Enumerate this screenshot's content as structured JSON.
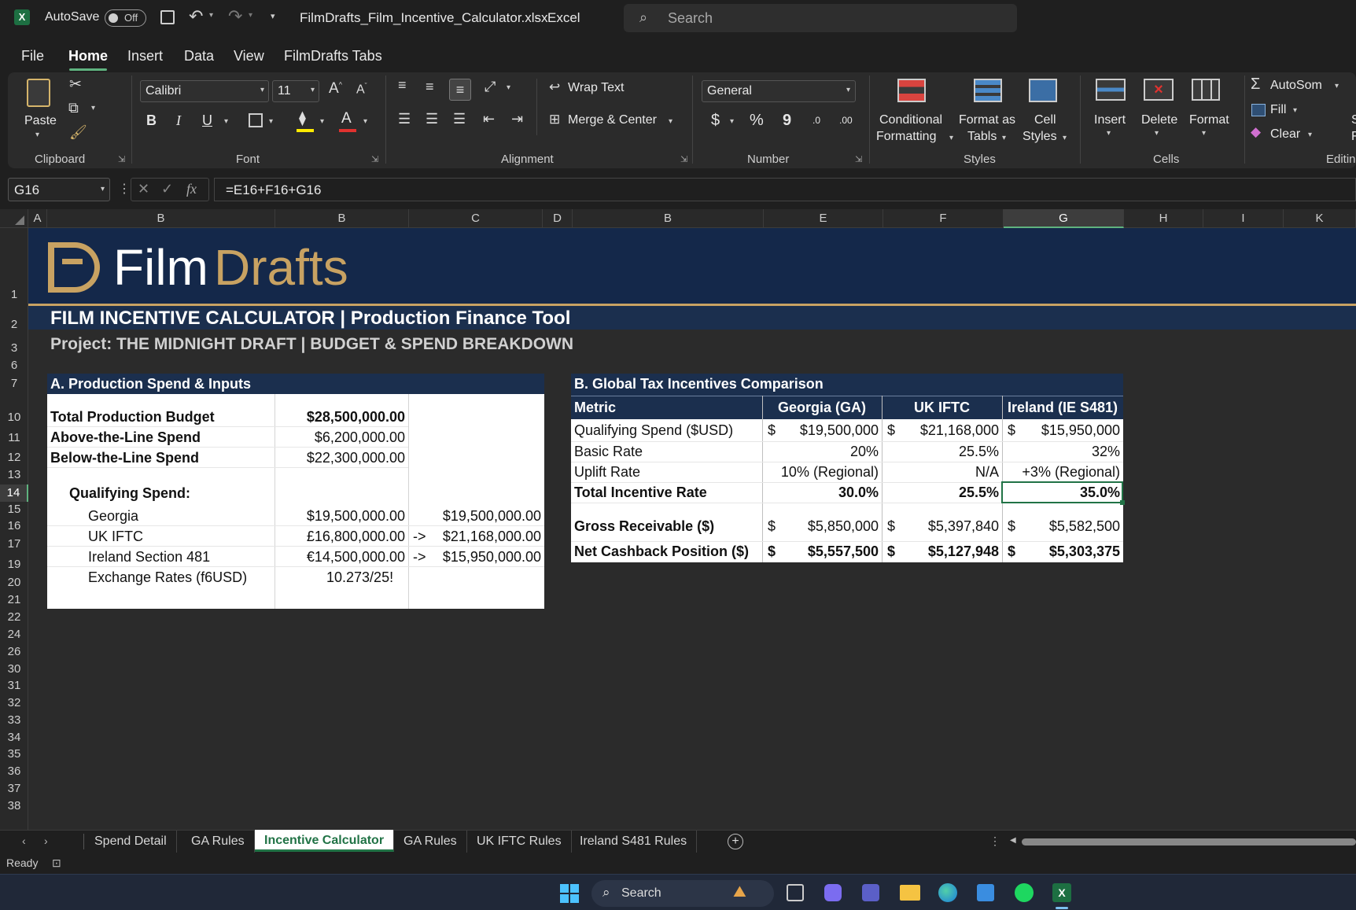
{
  "titlebar": {
    "autosave_label": "AutoSave",
    "autosave_state": "Off",
    "filename": "FilmDrafts_Film_Incentive_Calculator.xlsx",
    "separator": "-",
    "app": "Excel",
    "search_placeholder": "Search"
  },
  "menu": [
    "File",
    "Home",
    "Insert",
    "Data",
    "View",
    "FilmDrafts Tabs"
  ],
  "ribbon": {
    "clipboard": {
      "paste": "Paste",
      "label": "Clipboard"
    },
    "font": {
      "name": "Calibri",
      "size": "11",
      "bold": "B",
      "italic": "I",
      "underline": "U",
      "font_color_glyph": "A",
      "label": "Font"
    },
    "alignment": {
      "wrap_text": "Wrap Text",
      "merge_center": "Merge & Center",
      "label": "Alignment"
    },
    "number": {
      "format": "General",
      "currency": "$",
      "percent": "%",
      "comma": "9",
      "inc_decimal": ".0",
      "dec_decimal": ".00",
      "label": "Number"
    },
    "styles": {
      "conditional_1": "Conditional",
      "conditional_2": "Formatting",
      "format_table_1": "Format as",
      "format_table_2": "Tabls",
      "cell_styles_1": "Cell",
      "cell_styles_2": "Styles",
      "label": "Styles"
    },
    "cells": {
      "insert": "Insert",
      "delete": "Delete",
      "format": "Format",
      "label": "Cells"
    },
    "editing": {
      "autosum": "AutoSom",
      "fill": "Fill",
      "clear": "Clear",
      "label": "Editin",
      "partial_top": "S",
      "partial_mid": "F"
    }
  },
  "formula_bar": {
    "name_box": "G16",
    "fx": "fx",
    "formula": "=E16+F16+G16"
  },
  "columns": [
    "A",
    "B",
    "B",
    "C",
    "D",
    "B",
    "E",
    "F",
    "G",
    "H",
    "I",
    "K"
  ],
  "rows": [
    "1",
    "2",
    "3",
    "6",
    "7",
    "10",
    "11",
    "12",
    "13",
    "14",
    "15",
    "16",
    "17",
    "19",
    "20",
    "21",
    "22",
    "24",
    "26",
    "30",
    "31",
    "32",
    "33",
    "34",
    "35",
    "36",
    "37",
    "38"
  ],
  "banner": {
    "logo_first": "Film",
    "logo_second": "Drafts",
    "title": "FILM INCENTIVE CALCULATOR | Production Finance Tool",
    "subtitle": "Project: THE MIDNIGHT DRAFT | BUDGET & SPEND BREAKDOWN"
  },
  "section_a": {
    "header": "A. Production Spend & Inputs",
    "budget_label": "Total Production Budget",
    "budget_value": "$28,500,000.00",
    "atl_label": "Above-the-Line Spend",
    "atl_value": "$6,200,000.00",
    "btl_label": "Below-the-Line Spend",
    "btl_value": "$22,300,000.00",
    "qualifying_label": "Qualifying Spend:",
    "georgia_label": "Georgia",
    "georgia_value": "$19,500,000.00",
    "georgia_usd": "$19,500,000.00",
    "uk_label": "UK IFTC",
    "uk_value": "£16,800,000.00",
    "uk_arrow": "->",
    "uk_usd": "$21,168,000.00",
    "ireland_label": "Ireland Section 481",
    "ireland_value": "€14,500,000.00",
    "ireland_arrow": "->",
    "ireland_usd": "$15,950,000.00",
    "fx_label": "Exchange Rates (f6USD)",
    "fx_value": "10.273/25!"
  },
  "section_b": {
    "header": "B. Global Tax Incentives Comparison",
    "col_metric": "Metric",
    "col_ga": "Georgia (GA)",
    "col_uk": "UK IFTC",
    "col_ie": "Ireland (IE S481)",
    "qs_label": "Qualifying Spend ($USD)",
    "qs_ga": "$19,500,000",
    "qs_uk": "$21,168,000",
    "qs_ie": "$15,950,000",
    "br_label": "Basic Rate",
    "br_ga": "20%",
    "br_uk": "25.5%",
    "br_ie": "32%",
    "ur_label": "Uplift Rate",
    "ur_ga": "10% (Regional)",
    "ur_uk": "N/A",
    "ur_ie": "+3% (Regional)",
    "tr_label": "Total Incentive Rate",
    "tr_ga": "30.0%",
    "tr_uk": "25.5%",
    "tr_ie": "35.0%",
    "gr_label": "Gross Receivable ($)",
    "gr_ga": "$5,850,000",
    "gr_uk": "$5,397,840",
    "gr_ie": "$5,582,500",
    "nc_label": "Net Cashback Position ($)",
    "nc_ga": "$5,557,500",
    "nc_uk": "$5,127,948",
    "nc_ie": "$5,303,375",
    "dollar": "$"
  },
  "tabs": [
    "Spend Detail",
    "GA Rules",
    "Incentive Calculator",
    "GA Rules",
    "UK IFTC Rules",
    "Ireland S481 Rules"
  ],
  "status": "Ready",
  "taskbar": {
    "search": "Search"
  },
  "colors": {
    "banner": "#14284a",
    "gold": "#c8a262",
    "accent": "#217346"
  }
}
